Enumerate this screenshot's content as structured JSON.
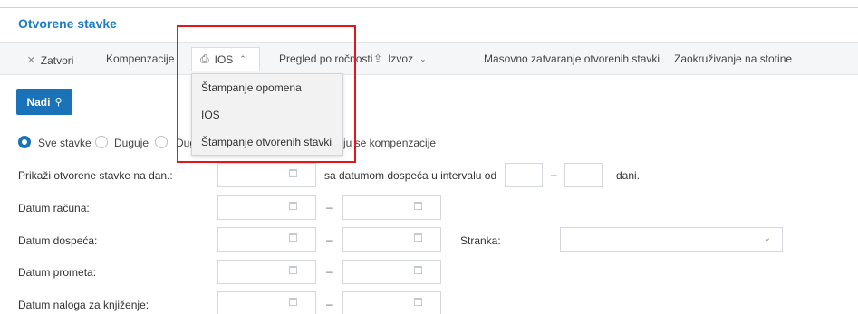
{
  "page": {
    "title": "Otvorene stavke"
  },
  "toolbar": {
    "close_label": "Zatvori",
    "close_icon": "×",
    "compensation_label": "Kompenzacije",
    "ios_label": "IOS",
    "ios_icon": "⎙",
    "ios_chevron": "⌃",
    "maturity_label": "Pregled po ročnosti",
    "export_label": "Izvoz",
    "export_icon": "⇪",
    "export_chevron": "⌄",
    "mass_close_label": "Masovno zatvaranje otvorenih stavki",
    "rounding_label": "Zaokruživanje na stotine"
  },
  "ios_menu": {
    "items": [
      "Štampanje opomena",
      "IOS",
      "Štampanje otvorenih stavki"
    ]
  },
  "search": {
    "button_label": "Nadi",
    "icon": "⚲"
  },
  "filter": {
    "radio_all": "Sve stavke",
    "radio_debit": "Duguje",
    "radio_partial": "Dug",
    "radio_suffix": "ju se kompenzacije",
    "selected": "Sve stavke"
  },
  "form": {
    "show_label": "Prikaži otvorene stavke na dan.:",
    "interval_label": "sa datumom dospeća u intervalu od",
    "days_label": "dani.",
    "invoice_date_label": "Datum računa:",
    "due_date_label": "Datum dospeća:",
    "customer_label": "Stranka:",
    "turnover_date_label": "Datum prometa:",
    "posting_date_label": "Datum naloga za knjiženje:",
    "dash": "–",
    "select_chevron": "⌄"
  },
  "colors": {
    "accent": "#1a73b8",
    "title": "#1c7cc4",
    "highlight": "#e0181c"
  }
}
